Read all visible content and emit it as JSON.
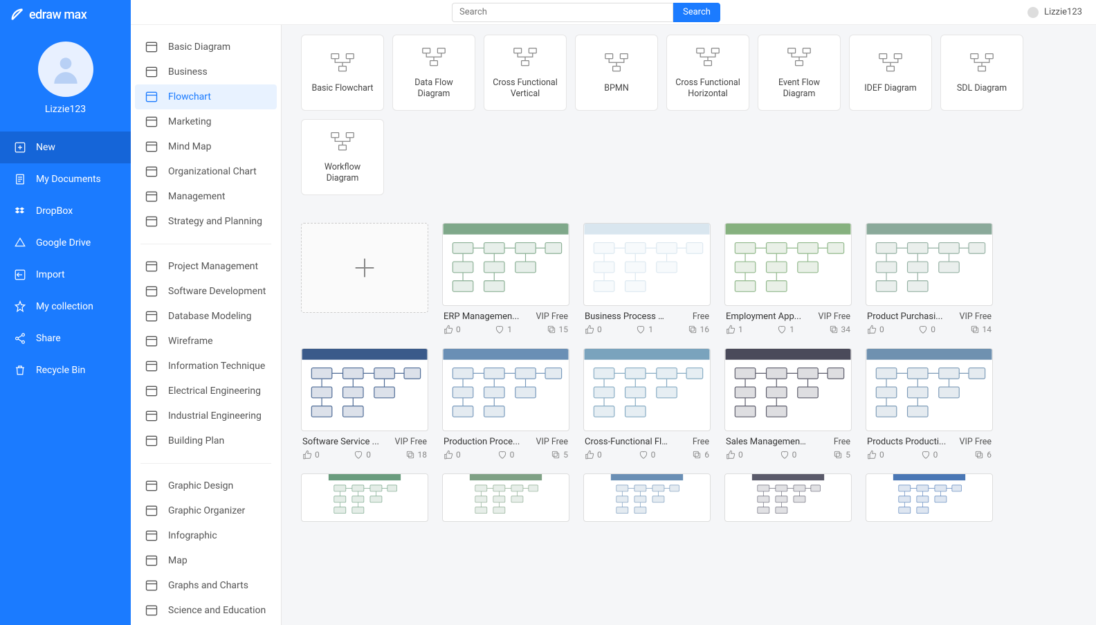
{
  "app_name": "edraw max",
  "search": {
    "placeholder": "Search",
    "button": "Search"
  },
  "user": {
    "name": "Lizzie123"
  },
  "profile": {
    "name": "Lizzie123"
  },
  "nav": [
    {
      "id": "new",
      "label": "New",
      "active": true
    },
    {
      "id": "mydocs",
      "label": "My Documents"
    },
    {
      "id": "dropbox",
      "label": "DropBox"
    },
    {
      "id": "gdrive",
      "label": "Google Drive"
    },
    {
      "id": "import",
      "label": "Import"
    },
    {
      "id": "collection",
      "label": "My collection"
    },
    {
      "id": "share",
      "label": "Share"
    },
    {
      "id": "recycle",
      "label": "Recycle Bin"
    }
  ],
  "cat_groups": [
    [
      "Basic Diagram",
      "Business",
      "Flowchart",
      "Marketing",
      "Mind Map",
      "Organizational Chart",
      "Management",
      "Strategy and Planning"
    ],
    [
      "Project Management",
      "Software Development",
      "Database Modeling",
      "Wireframe",
      "Information Technique",
      "Electrical Engineering",
      "Industrial Engineering",
      "Building Plan"
    ],
    [
      "Graphic Design",
      "Graphic Organizer",
      "Infographic",
      "Map",
      "Graphs and Charts",
      "Science and Education"
    ]
  ],
  "cat_selected": "Flowchart",
  "tiles": [
    "Basic Flowchart",
    "Data Flow Diagram",
    "Cross Functional Vertical",
    "BPMN",
    "Cross Functional Horizontal",
    "Event Flow Diagram",
    "IDEF Diagram",
    "SDL Diagram",
    "Workflow Diagram"
  ],
  "templates": [
    {
      "title": "ERP Managemen...",
      "badge": "VIP Free",
      "likes": 0,
      "favs": 1,
      "copies": 15,
      "color": "#7fa88a"
    },
    {
      "title": "Business Process Mo...",
      "badge": "Free",
      "likes": 0,
      "favs": 1,
      "copies": 16,
      "color": "#d9e6ef"
    },
    {
      "title": "Employment App...",
      "badge": "VIP Free",
      "likes": 1,
      "favs": 1,
      "copies": 34,
      "color": "#86b17f"
    },
    {
      "title": "Product Purchasi...",
      "badge": "VIP Free",
      "likes": 0,
      "favs": 0,
      "copies": 14,
      "color": "#8aa99a"
    },
    {
      "title": "Software Service ...",
      "badge": "VIP Free",
      "likes": 0,
      "favs": 0,
      "copies": 18,
      "color": "#3a5a8a"
    },
    {
      "title": "Production Proce...",
      "badge": "VIP Free",
      "likes": 0,
      "favs": 0,
      "copies": 5,
      "color": "#6a8fb5"
    },
    {
      "title": "Cross-Functional Flo...",
      "badge": "Free",
      "likes": 0,
      "favs": 0,
      "copies": 6,
      "color": "#7aa3bd"
    },
    {
      "title": "Sales Management C...",
      "badge": "Free",
      "likes": 0,
      "favs": 0,
      "copies": 5,
      "color": "#4a4a5a"
    },
    {
      "title": "Products Producti...",
      "badge": "VIP Free",
      "likes": 0,
      "favs": 0,
      "copies": 6,
      "color": "#6f91b0"
    }
  ]
}
